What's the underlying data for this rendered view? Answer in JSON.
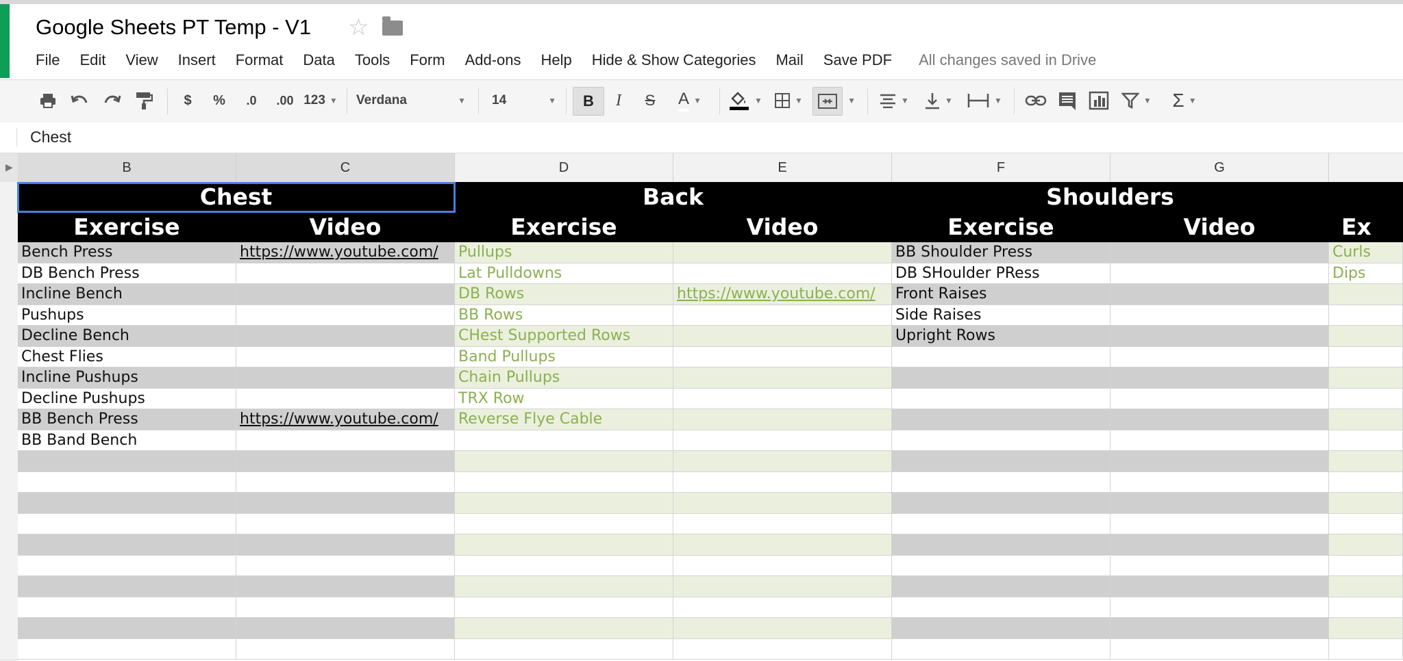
{
  "app": {
    "title": "Google Sheets PT Temp - V1",
    "menu": [
      "File",
      "Edit",
      "View",
      "Insert",
      "Format",
      "Data",
      "Tools",
      "Form",
      "Add-ons",
      "Help",
      "Hide & Show Categories",
      "Mail",
      "Save PDF"
    ],
    "save_status": "All changes saved in Drive"
  },
  "toolbar": {
    "currency": "$",
    "percent": "%",
    "dec_decrease": ".0",
    "dec_increase": ".00",
    "number_format": "123",
    "font": "Verdana",
    "font_size": "14",
    "bold": "B",
    "italic": "I",
    "strike": "S",
    "text_color": "A",
    "sum": "Σ"
  },
  "formula_bar": {
    "value": "Chest"
  },
  "columns": [
    "B",
    "C",
    "D",
    "E",
    "F",
    "G"
  ],
  "sheet": {
    "groups": [
      "Chest",
      "Back",
      "Shoulders"
    ],
    "subheaders": [
      "Exercise",
      "Video"
    ],
    "partial_header": "Ex",
    "chest": {
      "exercises": [
        "Bench Press",
        "DB Bench Press",
        "Incline Bench",
        "Pushups",
        "Decline Bench",
        "Chest Flies",
        "Incline Pushups",
        "Decline Pushups",
        "BB Bench Press",
        "BB Band Bench"
      ],
      "videos": [
        "https://www.youtube.com/",
        "",
        "",
        "",
        "",
        "",
        "",
        "",
        "https://www.youtube.com/",
        ""
      ]
    },
    "back": {
      "exercises": [
        "Pullups",
        "Lat Pulldowns",
        "DB Rows",
        "BB Rows",
        "CHest Supported Rows",
        "Band Pullups",
        "Chain Pullups",
        "TRX Row",
        "Reverse Flye Cable",
        ""
      ],
      "videos": [
        "",
        "",
        "https://www.youtube.com/",
        "",
        "",
        "",
        "",
        "",
        "",
        ""
      ]
    },
    "shoulders": {
      "exercises": [
        "BB Shoulder Press",
        "DB SHoulder PRess",
        "Front Raises",
        "Side Raises",
        "Upright Rows",
        "",
        "",
        "",
        "",
        ""
      ],
      "videos": [
        "",
        "",
        "",
        "",
        "",
        "",
        "",
        "",
        "",
        ""
      ]
    },
    "arms_partial": [
      "Curls",
      "Dips"
    ]
  },
  "colors": {
    "header_bg": "#000000",
    "gray_band": "#cfcfcf",
    "green_band": "#ebf0de",
    "green_text": "#8bb050",
    "selection": "#4a7fe0",
    "sheets_green": "#0f9d58"
  }
}
